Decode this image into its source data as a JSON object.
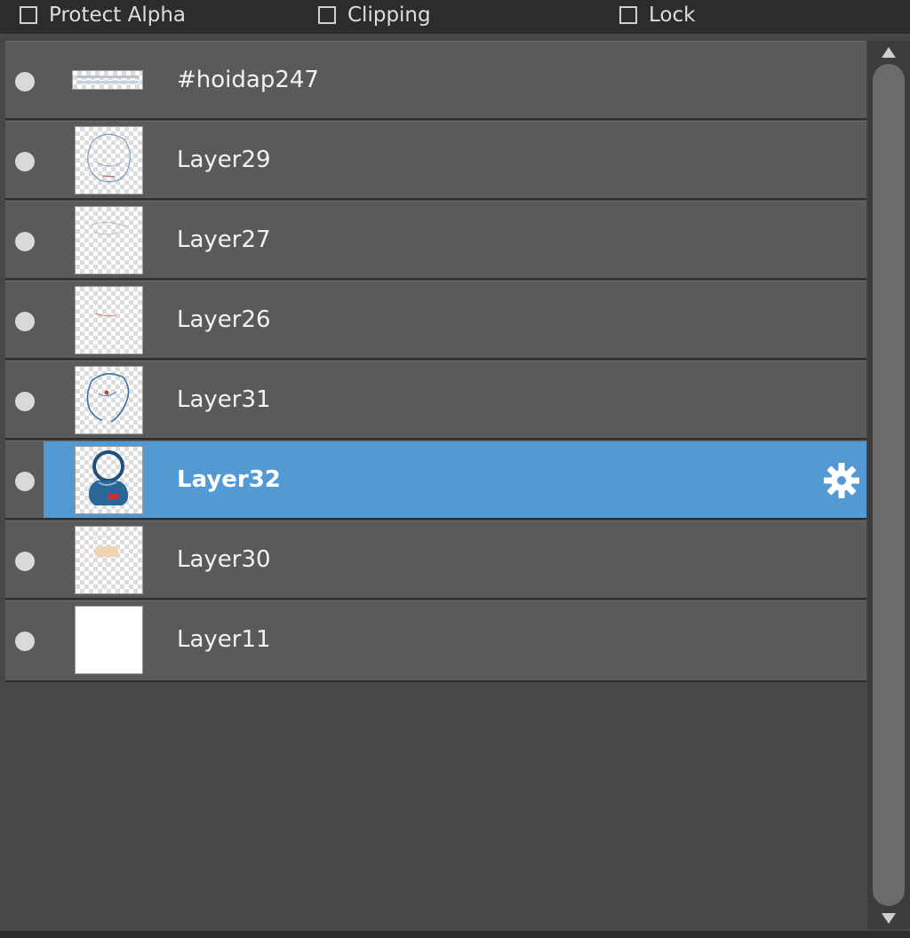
{
  "options": {
    "protect_alpha": {
      "label": "Protect Alpha",
      "checked": false
    },
    "clipping": {
      "label": "Clipping",
      "checked": false
    },
    "lock": {
      "label": "Lock",
      "checked": false
    }
  },
  "layers": [
    {
      "name": "#hoidap247",
      "visible": true,
      "selected": false
    },
    {
      "name": "Layer29",
      "visible": true,
      "selected": false
    },
    {
      "name": "Layer27",
      "visible": true,
      "selected": false
    },
    {
      "name": "Layer26",
      "visible": true,
      "selected": false
    },
    {
      "name": "Layer31",
      "visible": true,
      "selected": false
    },
    {
      "name": "Layer32",
      "visible": true,
      "selected": true
    },
    {
      "name": "Layer30",
      "visible": true,
      "selected": false
    },
    {
      "name": "Layer11",
      "visible": true,
      "selected": false
    }
  ],
  "colors": {
    "selection": "#5399d3",
    "row": "#5a5a5a",
    "panel": "#484746"
  },
  "icons": {
    "visibility": "visibility-dot-icon",
    "settings": "gear-icon",
    "scroll_up": "triangle-up-icon",
    "scroll_down": "triangle-down-icon"
  }
}
